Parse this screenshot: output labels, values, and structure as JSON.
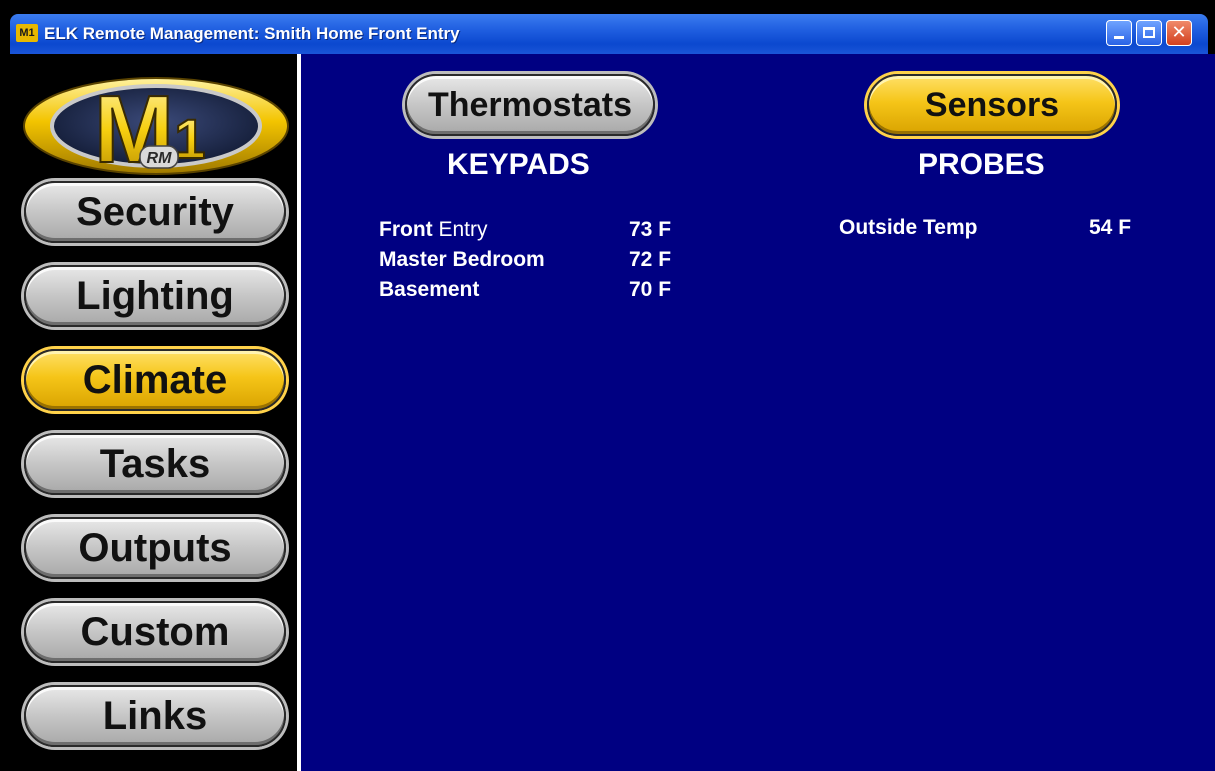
{
  "window": {
    "title": "ELK Remote Management: Smith Home  Front Entry",
    "icon_label": "M1"
  },
  "logo": {
    "main": "M",
    "sub": "1",
    "badge": "RM"
  },
  "sidebar": {
    "items": [
      {
        "label": "Security",
        "state": "normal"
      },
      {
        "label": "Lighting",
        "state": "normal"
      },
      {
        "label": "Climate",
        "state": "active"
      },
      {
        "label": "Tasks",
        "state": "normal"
      },
      {
        "label": "Outputs",
        "state": "normal"
      },
      {
        "label": "Custom",
        "state": "normal"
      },
      {
        "label": "Links",
        "state": "normal"
      }
    ]
  },
  "main": {
    "buttons": {
      "thermostats": "Thermostats",
      "sensors": "Sensors"
    },
    "keypads": {
      "heading": "KEYPADS",
      "rows": [
        {
          "name_bold": "Front",
          "name_rest": "Entry",
          "temp": "73 F"
        },
        {
          "name_bold": "Master Bedroom",
          "name_rest": "",
          "temp": "72 F"
        },
        {
          "name_bold": "Basement",
          "name_rest": "",
          "temp": "70 F"
        }
      ]
    },
    "probes": {
      "heading": "PROBES",
      "rows": [
        {
          "name": "Outside Temp",
          "temp": "54 F"
        }
      ]
    }
  },
  "colors": {
    "main_bg": "#000082",
    "active_button": "#f5c518",
    "inactive_button": "#c9c9c9",
    "titlebar": "#1f5ee0"
  }
}
